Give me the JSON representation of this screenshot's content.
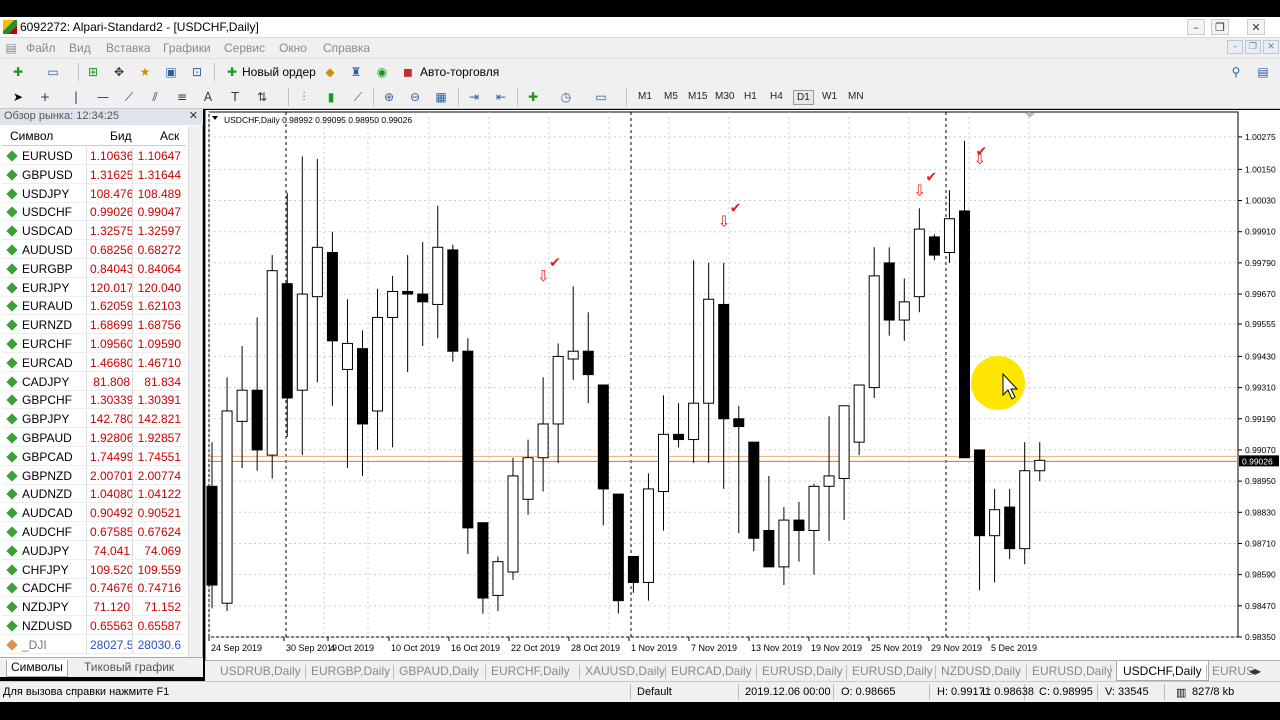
{
  "window": {
    "title": "6092272: Alpari-Standard2 - [USDCHF,Daily]"
  },
  "menu": [
    "Файл",
    "Вид",
    "Вставка",
    "Графики",
    "Сервис",
    "Окно",
    "Справка"
  ],
  "toolbar": {
    "new_order": "Новый ордер",
    "auto_trading": "Авто-торговля"
  },
  "timeframes": [
    "M1",
    "M5",
    "M15",
    "M30",
    "H1",
    "H4",
    "D1",
    "W1",
    "MN"
  ],
  "selected_timeframe": "D1",
  "market_watch": {
    "header": "Обзор рынка: 12:34:25",
    "col_symbol": "Символ",
    "col_bid": "Бид",
    "col_ask": "Аск",
    "rows": [
      {
        "symbol": "EURUSD",
        "bid": "1.10636",
        "ask": "1.10647"
      },
      {
        "symbol": "GBPUSD",
        "bid": "1.31625",
        "ask": "1.31644"
      },
      {
        "symbol": "USDJPY",
        "bid": "108.476",
        "ask": "108.489"
      },
      {
        "symbol": "USDCHF",
        "bid": "0.99026",
        "ask": "0.99047"
      },
      {
        "symbol": "USDCAD",
        "bid": "1.32575",
        "ask": "1.32597"
      },
      {
        "symbol": "AUDUSD",
        "bid": "0.68256",
        "ask": "0.68272"
      },
      {
        "symbol": "EURGBP",
        "bid": "0.84043",
        "ask": "0.84064"
      },
      {
        "symbol": "EURJPY",
        "bid": "120.017",
        "ask": "120.040"
      },
      {
        "symbol": "EURAUD",
        "bid": "1.62059",
        "ask": "1.62103"
      },
      {
        "symbol": "EURNZD",
        "bid": "1.68699",
        "ask": "1.68756"
      },
      {
        "symbol": "EURCHF",
        "bid": "1.09560",
        "ask": "1.09590"
      },
      {
        "symbol": "EURCAD",
        "bid": "1.46680",
        "ask": "1.46710"
      },
      {
        "symbol": "CADJPY",
        "bid": "81.808",
        "ask": "81.834"
      },
      {
        "symbol": "GBPCHF",
        "bid": "1.30339",
        "ask": "1.30391"
      },
      {
        "symbol": "GBPJPY",
        "bid": "142.780",
        "ask": "142.821"
      },
      {
        "symbol": "GBPAUD",
        "bid": "1.92806",
        "ask": "1.92857"
      },
      {
        "symbol": "GBPCAD",
        "bid": "1.74499",
        "ask": "1.74551"
      },
      {
        "symbol": "GBPNZD",
        "bid": "2.00701",
        "ask": "2.00774"
      },
      {
        "symbol": "AUDNZD",
        "bid": "1.04080",
        "ask": "1.04122"
      },
      {
        "symbol": "AUDCAD",
        "bid": "0.90492",
        "ask": "0.90521"
      },
      {
        "symbol": "AUDCHF",
        "bid": "0.67585",
        "ask": "0.67624"
      },
      {
        "symbol": "AUDJPY",
        "bid": "74.041",
        "ask": "74.069"
      },
      {
        "symbol": "CHFJPY",
        "bid": "109.520",
        "ask": "109.559"
      },
      {
        "symbol": "CADCHF",
        "bid": "0.74676",
        "ask": "0.74716"
      },
      {
        "symbol": "NZDJPY",
        "bid": "71.120",
        "ask": "71.152"
      },
      {
        "symbol": "NZDUSD",
        "bid": "0.65563",
        "ask": "0.65587"
      },
      {
        "symbol": "_DJI",
        "bid": "28027.5",
        "ask": "28030.6"
      }
    ],
    "tab_symbols": "Символы",
    "tab_tick": "Тиковый график"
  },
  "chart": {
    "info": "USDCHF,Daily  0.98992 0.99095 0.98950 0.99026",
    "current_price": "0.99026",
    "price_labels": [
      "1.00275",
      "1.00150",
      "1.00030",
      "0.99910",
      "0.99790",
      "0.99670",
      "0.99555",
      "0.99430",
      "0.99310",
      "0.99190",
      "0.99070",
      "0.98950",
      "0.98830",
      "0.98710",
      "0.98590",
      "0.98470",
      "0.98350"
    ],
    "date_labels": [
      "24 Sep 2019",
      "30 Sep 2019",
      "4 Oct 2019",
      "10 Oct 2019",
      "16 Oct 2019",
      "22 Oct 2019",
      "28 Oct 2019",
      "1 Nov 2019",
      "7 Nov 2019",
      "13 Nov 2019",
      "19 Nov 2019",
      "25 Nov 2019",
      "29 Nov 2019",
      "5 Dec 2019"
    ]
  },
  "chart_data": {
    "type": "candlestick",
    "symbol": "USDCHF",
    "timeframe": "Daily",
    "ylim": [
      0.9835,
      1.0034
    ],
    "candles": [
      {
        "o": 0.9893,
        "h": 0.991,
        "l": 0.9846,
        "c": 0.9855
      },
      {
        "o": 0.9848,
        "h": 0.9935,
        "l": 0.9845,
        "c": 0.9922
      },
      {
        "o": 0.9918,
        "h": 0.9947,
        "l": 0.99,
        "c": 0.993
      },
      {
        "o": 0.993,
        "h": 0.9958,
        "l": 0.9899,
        "c": 0.9907
      },
      {
        "o": 0.9905,
        "h": 0.9982,
        "l": 0.9896,
        "c": 0.9976
      },
      {
        "o": 0.9971,
        "h": 1.0006,
        "l": 0.9912,
        "c": 0.9927
      },
      {
        "o": 0.993,
        "h": 1.002,
        "l": 0.9905,
        "c": 0.9967
      },
      {
        "o": 0.9966,
        "h": 1.0019,
        "l": 0.9933,
        "c": 0.9985
      },
      {
        "o": 0.9983,
        "h": 0.9991,
        "l": 0.9924,
        "c": 0.9949
      },
      {
        "o": 0.9938,
        "h": 0.9965,
        "l": 0.99,
        "c": 0.9948
      },
      {
        "o": 0.9946,
        "h": 0.9953,
        "l": 0.9897,
        "c": 0.9917
      },
      {
        "o": 0.9922,
        "h": 0.9969,
        "l": 0.9907,
        "c": 0.9958
      },
      {
        "o": 0.9958,
        "h": 0.9974,
        "l": 0.9908,
        "c": 0.9968
      },
      {
        "o": 0.9968,
        "h": 0.9982,
        "l": 0.9937,
        "c": 0.9967
      },
      {
        "o": 0.9967,
        "h": 0.9987,
        "l": 0.9947,
        "c": 0.9964
      },
      {
        "o": 0.9963,
        "h": 1.0001,
        "l": 0.995,
        "c": 0.9985
      },
      {
        "o": 0.9984,
        "h": 0.9986,
        "l": 0.9941,
        "c": 0.9945
      },
      {
        "o": 0.9945,
        "h": 0.995,
        "l": 0.9867,
        "c": 0.9877
      },
      {
        "o": 0.9879,
        "h": 0.9879,
        "l": 0.9844,
        "c": 0.985
      },
      {
        "o": 0.9851,
        "h": 0.9866,
        "l": 0.9845,
        "c": 0.9864
      },
      {
        "o": 0.986,
        "h": 0.9904,
        "l": 0.9857,
        "c": 0.9897
      },
      {
        "o": 0.9888,
        "h": 0.9911,
        "l": 0.9882,
        "c": 0.9904
      },
      {
        "o": 0.9904,
        "h": 0.9935,
        "l": 0.9891,
        "c": 0.9917
      },
      {
        "o": 0.9917,
        "h": 0.9948,
        "l": 0.9902,
        "c": 0.9943
      },
      {
        "o": 0.9942,
        "h": 0.997,
        "l": 0.9934,
        "c": 0.9945
      },
      {
        "o": 0.9945,
        "h": 0.996,
        "l": 0.9925,
        "c": 0.9936
      },
      {
        "o": 0.9932,
        "h": 0.9932,
        "l": 0.9878,
        "c": 0.9892
      },
      {
        "o": 0.989,
        "h": 0.989,
        "l": 0.9844,
        "c": 0.9849
      },
      {
        "o": 0.9866,
        "h": 0.9866,
        "l": 0.9852,
        "c": 0.9856
      },
      {
        "o": 0.9856,
        "h": 0.9898,
        "l": 0.9849,
        "c": 0.9892
      },
      {
        "o": 0.9891,
        "h": 0.9928,
        "l": 0.9876,
        "c": 0.9913
      },
      {
        "o": 0.9913,
        "h": 0.9925,
        "l": 0.9908,
        "c": 0.9911
      },
      {
        "o": 0.9911,
        "h": 0.998,
        "l": 0.9902,
        "c": 0.9925
      },
      {
        "o": 0.9925,
        "h": 0.9979,
        "l": 0.9902,
        "c": 0.9965
      },
      {
        "o": 0.9963,
        "h": 0.9979,
        "l": 0.9892,
        "c": 0.9919
      },
      {
        "o": 0.9919,
        "h": 0.9924,
        "l": 0.9875,
        "c": 0.9916
      },
      {
        "o": 0.991,
        "h": 0.991,
        "l": 0.9868,
        "c": 0.9873
      },
      {
        "o": 0.9876,
        "h": 0.9897,
        "l": 0.9864,
        "c": 0.9862
      },
      {
        "o": 0.9862,
        "h": 0.9885,
        "l": 0.9855,
        "c": 0.988
      },
      {
        "o": 0.988,
        "h": 0.9887,
        "l": 0.9864,
        "c": 0.9876
      },
      {
        "o": 0.9876,
        "h": 0.9894,
        "l": 0.9859,
        "c": 0.9893
      },
      {
        "o": 0.9893,
        "h": 0.992,
        "l": 0.9872,
        "c": 0.9897
      },
      {
        "o": 0.9896,
        "h": 0.992,
        "l": 0.988,
        "c": 0.9924
      },
      {
        "o": 0.991,
        "h": 0.9932,
        "l": 0.9905,
        "c": 0.9932
      },
      {
        "o": 0.9931,
        "h": 0.9985,
        "l": 0.9927,
        "c": 0.9974
      },
      {
        "o": 0.9979,
        "h": 0.9985,
        "l": 0.9951,
        "c": 0.9957
      },
      {
        "o": 0.9957,
        "h": 0.9973,
        "l": 0.9949,
        "c": 0.9964
      },
      {
        "o": 0.9966,
        "h": 1.0,
        "l": 0.996,
        "c": 0.9992
      },
      {
        "o": 0.9989,
        "h": 0.999,
        "l": 0.998,
        "c": 0.9982
      },
      {
        "o": 0.9983,
        "h": 1.0007,
        "l": 0.9979,
        "c": 0.9996
      },
      {
        "o": 0.9999,
        "h": 1.0026,
        "l": 0.9992,
        "c": 0.9904
      },
      {
        "o": 0.9907,
        "h": 0.9907,
        "l": 0.9853,
        "c": 0.9874
      },
      {
        "o": 0.9874,
        "h": 0.9892,
        "l": 0.9856,
        "c": 0.9884
      },
      {
        "o": 0.9885,
        "h": 0.9892,
        "l": 0.9865,
        "c": 0.9869
      },
      {
        "o": 0.9869,
        "h": 0.991,
        "l": 0.9863,
        "c": 0.9899
      },
      {
        "o": 0.9899,
        "h": 0.991,
        "l": 0.9895,
        "c": 0.9903
      }
    ]
  },
  "chart_tabs": [
    "USDRUB,Daily",
    "EURGBP,Daily",
    "GBPAUD,Daily",
    "EURCHF,Daily",
    "XAUUSD,Daily",
    "EURCAD,Daily",
    "EURUSD,Daily",
    "EURUSD,Daily",
    "NZDUSD,Daily",
    "EURUSD,Daily",
    "USDCHF,Daily",
    "EURUS"
  ],
  "selected_chart_tab": "USDCHF,Daily",
  "status": {
    "help": "Для вызова справки нажмите F1",
    "profile": "Default",
    "datetime": "2019.12.06 00:00",
    "open": "O: 0.98665",
    "high": "H: 0.99171",
    "low": "L: 0.98638",
    "close": "C: 0.98995",
    "volume": "V: 33545",
    "traffic": "827/8 kb"
  },
  "colors": {
    "bid_ask": "#cc0000",
    "bull_candle": "#ffffff",
    "bear_candle": "#000000",
    "price_line": "#e07030",
    "signal": "#e02020",
    "cursor_highlight": "#ffe600"
  }
}
